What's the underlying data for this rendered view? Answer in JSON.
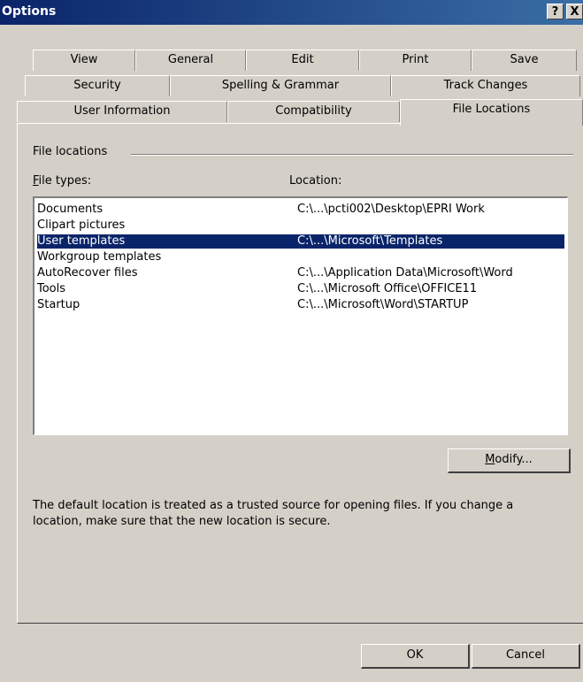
{
  "window": {
    "title": "Options",
    "help_label": "?",
    "close_label": "X"
  },
  "tabs": {
    "row1": [
      "View",
      "General",
      "Edit",
      "Print",
      "Save"
    ],
    "row2": [
      "Security",
      "Spelling & Grammar",
      "Track Changes"
    ],
    "row3": [
      "User Information",
      "Compatibility",
      "File Locations"
    ],
    "active": "File Locations"
  },
  "group": {
    "label": "File locations"
  },
  "columns": {
    "file_types": "File types:",
    "file_types_accel": "F",
    "file_types_rest": "ile types:",
    "location": "Location:"
  },
  "rows": [
    {
      "type": "Documents",
      "location": "C:\\...\\pcti002\\Desktop\\EPRI Work",
      "selected": false
    },
    {
      "type": "Clipart pictures",
      "location": "",
      "selected": false
    },
    {
      "type": "User templates",
      "location": "C:\\...\\Microsoft\\Templates",
      "selected": true
    },
    {
      "type": "Workgroup templates",
      "location": "",
      "selected": false
    },
    {
      "type": "AutoRecover files",
      "location": "C:\\...\\Application Data\\Microsoft\\Word",
      "selected": false
    },
    {
      "type": "Tools",
      "location": "C:\\...\\Microsoft Office\\OFFICE11",
      "selected": false
    },
    {
      "type": "Startup",
      "location": "C:\\...\\Microsoft\\Word\\STARTUP",
      "selected": false
    }
  ],
  "modify": {
    "accel": "M",
    "rest": "odify..."
  },
  "note": "The default location is treated as a trusted source for opening files. If you change a location, make sure that the new location is secure.",
  "footer": {
    "ok": "OK",
    "cancel": "Cancel"
  },
  "colors": {
    "titlebar": "#0a246a",
    "selection": "#0a246a",
    "face": "#d4d0c8"
  }
}
